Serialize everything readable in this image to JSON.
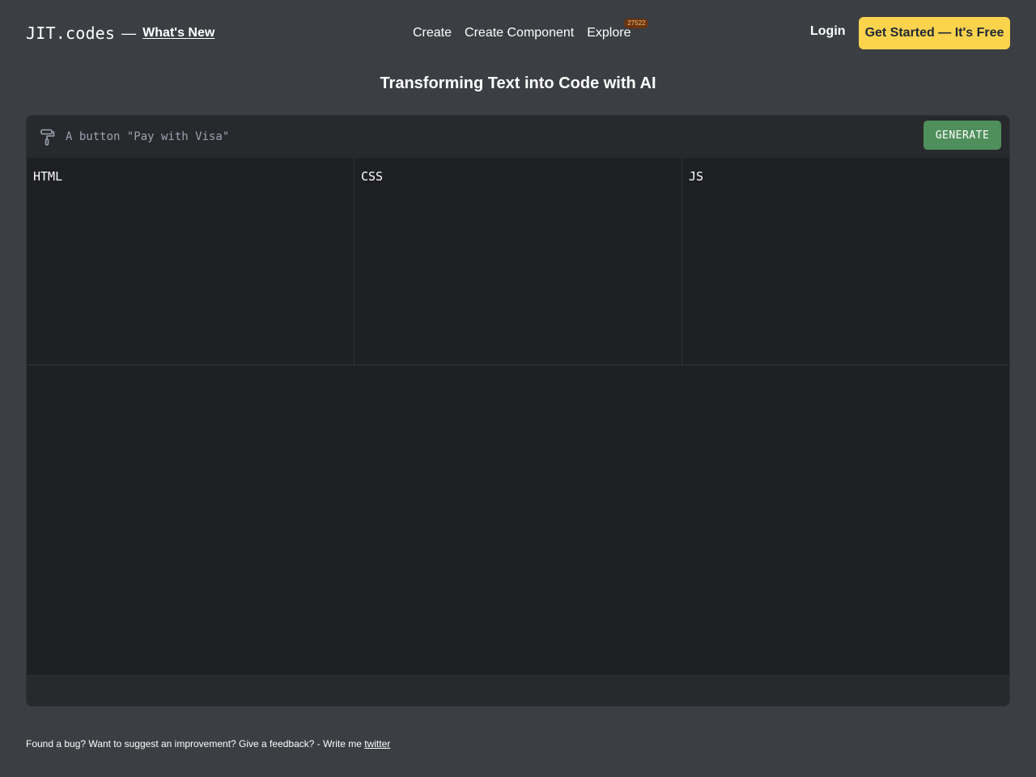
{
  "header": {
    "logo": "JIT.codes",
    "separator": "—",
    "whats_new": "What's New",
    "nav": [
      {
        "label": "Create"
      },
      {
        "label": "Create Component"
      },
      {
        "label": "Explore",
        "badge": "27522"
      }
    ],
    "login": "Login",
    "cta": "Get Started — It's Free"
  },
  "page": {
    "title": "Transforming Text into Code with AI"
  },
  "prompt": {
    "icon": "paint-roller-icon",
    "placeholder": "A button \"Pay with Visa\"",
    "value": "",
    "generate_label": "GENERATE"
  },
  "editors": [
    {
      "label": "HTML"
    },
    {
      "label": "CSS"
    },
    {
      "label": "JS"
    }
  ],
  "footer": {
    "text": "Found a bug? Want to suggest an improvement? Give a feedback? - Write me",
    "link": "twitter"
  },
  "colors": {
    "background": "#3b3e42",
    "panel": "#27292d",
    "editor": "#1f2024",
    "cta": "#fcd34d",
    "generate": "#4f8f5b",
    "badge": "#6b3410"
  }
}
